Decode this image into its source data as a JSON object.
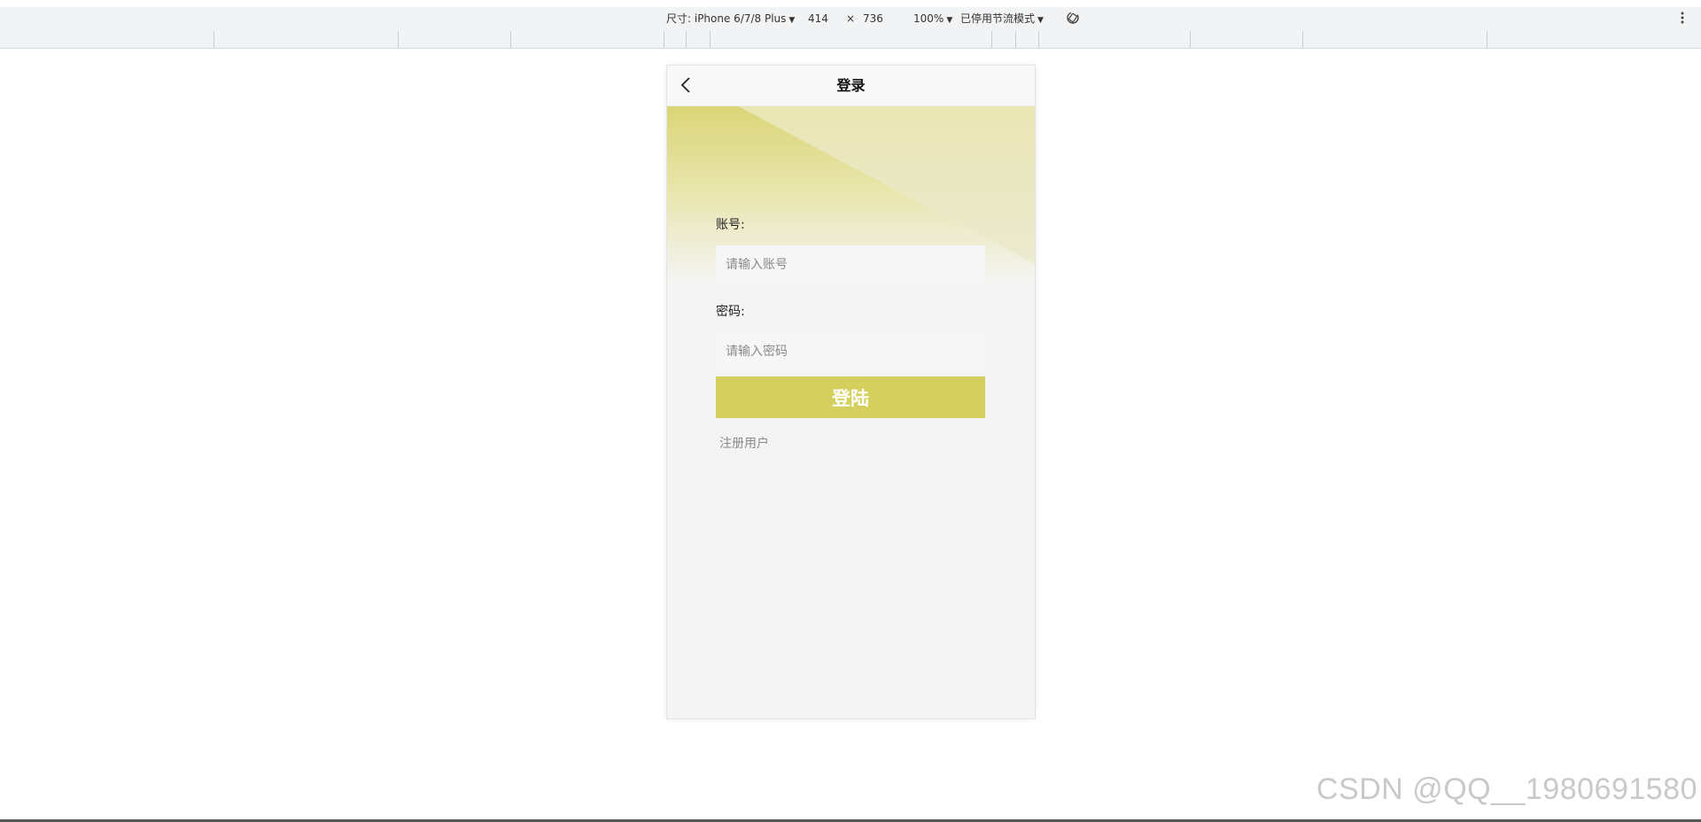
{
  "devtools": {
    "device_label": "尺寸: iPhone 6/7/8 Plus",
    "width": "414",
    "times": "×",
    "height": "736",
    "zoom": "100%",
    "throttle": "已停用节流模式",
    "rotate_icon": "rotate-icon",
    "more_icon": "more-vertical-icon"
  },
  "app": {
    "nav_title": "登录",
    "back_icon": "chevron-left-icon",
    "account_label": "账号:",
    "account_placeholder": "请输入账号",
    "account_value": "",
    "password_label": "密码:",
    "password_placeholder": "请输入密码",
    "password_value": "",
    "login_button": "登陆",
    "register_link": "注册用户",
    "accent_color": "#d5d05e"
  },
  "watermark": "CSDN @QQ__1980691580"
}
